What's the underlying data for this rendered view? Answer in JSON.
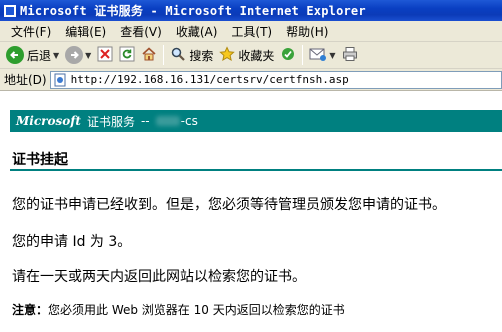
{
  "window": {
    "title": "Microsoft 证书服务 - Microsoft Internet Explorer"
  },
  "menubar": {
    "items": [
      {
        "label": "文件(F)"
      },
      {
        "label": "编辑(E)"
      },
      {
        "label": "查看(V)"
      },
      {
        "label": "收藏(A)"
      },
      {
        "label": "工具(T)"
      },
      {
        "label": "帮助(H)"
      }
    ]
  },
  "toolbar": {
    "back_label": "后退",
    "search_label": "搜索",
    "favorites_label": "收藏夹"
  },
  "addressbar": {
    "label": "地址(D)",
    "url": "http://192.168.16.131/certsrv/certfnsh.asp"
  },
  "page": {
    "banner": {
      "brand": "Microsoft",
      "service": "证书服务",
      "separator": "--",
      "ca_suffix": "-cs"
    },
    "heading": "证书挂起",
    "paragraph1": "您的证书申请已经收到。但是，您必须等待管理员颁发您申请的证书。",
    "paragraph2": "您的申请 Id 为 3。",
    "paragraph3": "请在一天或两天内返回此网站以检索您的证书。",
    "note_label": "注意：",
    "note_text": "您必须用此 Web 浏览器在 10 天内返回以检索您的证书"
  },
  "colors": {
    "titlebar": "#0a3fc2",
    "chrome": "#ece9d8",
    "banner": "#008080"
  }
}
